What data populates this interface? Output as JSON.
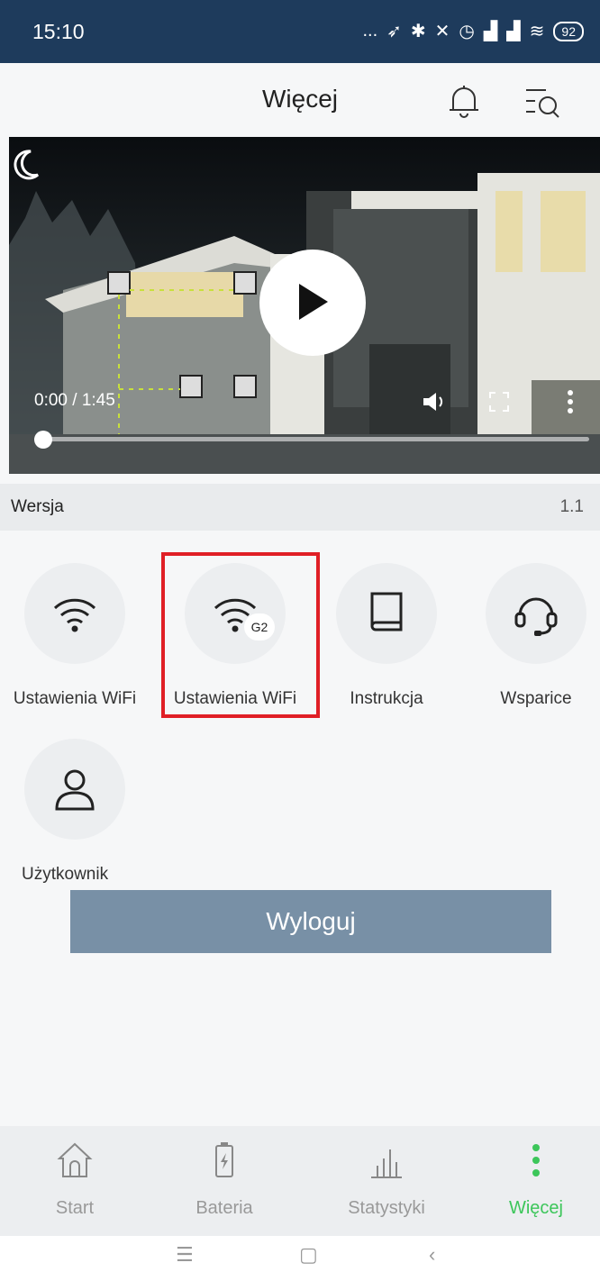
{
  "status_bar": {
    "time": "15:10",
    "dots": "...",
    "battery": "92"
  },
  "header": {
    "title": "Więcej",
    "icons": [
      "bell-icon",
      "search-list-icon"
    ]
  },
  "video": {
    "time": "0:00 / 1:45",
    "progress": 0,
    "icons": [
      "moon-icon",
      "play-icon",
      "volume-icon",
      "fullscreen-icon",
      "more-vertical-icon"
    ]
  },
  "version": {
    "label": "Wersja",
    "value": "1.1"
  },
  "grid": {
    "items": [
      {
        "label": "Ustawienia WiFi",
        "icon": "wifi-icon"
      },
      {
        "label": "Ustawienia WiFi",
        "icon": "wifi-g2-icon",
        "badge": "G2",
        "highlighted": true
      },
      {
        "label": "Instrukcja",
        "icon": "book-icon"
      },
      {
        "label": "Wsparice",
        "icon": "headset-icon"
      },
      {
        "label": "Użytkownik",
        "icon": "user-icon"
      }
    ]
  },
  "logout_label": "Wyloguj",
  "bottom_nav": {
    "items": [
      {
        "label": "Start",
        "icon": "home-icon"
      },
      {
        "label": "Bateria",
        "icon": "battery-icon"
      },
      {
        "label": "Statystyki",
        "icon": "bar-chart-icon"
      },
      {
        "label": "Więcej",
        "icon": "more-dots-icon",
        "active": true
      }
    ]
  },
  "colors": {
    "status_bar": "#1e3b5c",
    "accent_active": "#3cc65a",
    "logout_button": "#7890a6",
    "highlight_box": "#e01f26"
  }
}
